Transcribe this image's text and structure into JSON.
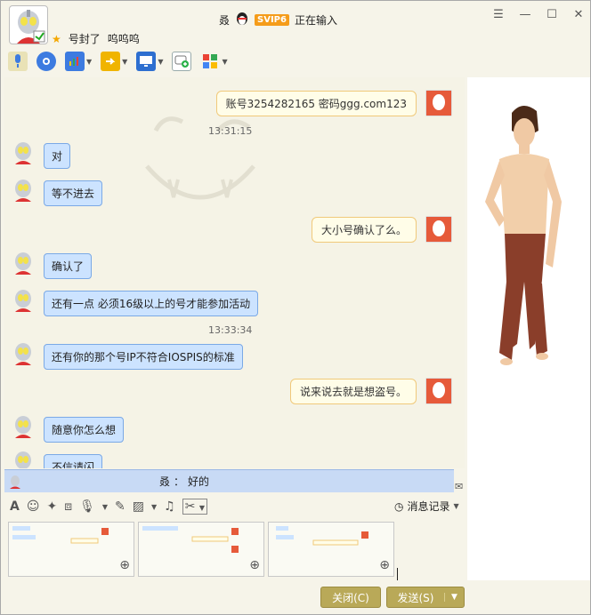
{
  "titlebar": {
    "nick_prefix": "叒",
    "svip": "SVIP6",
    "status": "正在输入",
    "controls": [
      "☰",
      "—",
      "☐",
      "✕"
    ]
  },
  "contact": {
    "name": "号封了",
    "signature": "呜呜呜"
  },
  "toolbar": {
    "items": [
      "microphone-icon",
      "video-icon",
      "app-share-icon",
      "file-transfer-icon",
      "remote-desktop-icon",
      "group-chat-icon",
      "apps-icon"
    ]
  },
  "chat": {
    "messages": [
      {
        "side": "right",
        "text": "账号3254282165     密码ggg.com123"
      },
      {
        "time": "13:31:15"
      },
      {
        "side": "left",
        "text": "对"
      },
      {
        "side": "left",
        "text": "等不进去"
      },
      {
        "side": "right",
        "text": "大小号确认了么。"
      },
      {
        "side": "left",
        "text": "确认了"
      },
      {
        "side": "left",
        "text": "还有一点 必须16级以上的号才能参加活动"
      },
      {
        "time": "13:33:34"
      },
      {
        "side": "left",
        "text": "还有你的那个号IP不符合IOSPIS的标准"
      },
      {
        "side": "right",
        "text": "说来说去就是想盗号。"
      },
      {
        "side": "left",
        "text": "随意你怎么想"
      },
      {
        "side": "left",
        "text": "不信请闪"
      }
    ]
  },
  "notice": {
    "who": "叒",
    "sep": "：",
    "text": "好的"
  },
  "inputbar": {
    "history_label": "消息记录"
  },
  "buttons": {
    "close": "关闭(C)",
    "send": "发送(S)"
  },
  "colors": {
    "accent": "#b9a958",
    "bubble_left": "#cce3ff",
    "bubble_right": "#fffde8"
  }
}
